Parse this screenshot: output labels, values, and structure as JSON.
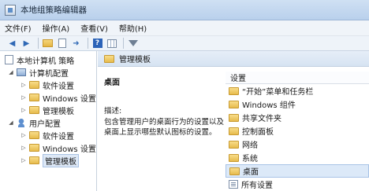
{
  "window": {
    "title": "本地组策略编辑器"
  },
  "menu": {
    "items": [
      "文件(F)",
      "操作(A)",
      "查看(V)",
      "帮助(H)"
    ]
  },
  "toolbar": {
    "icons": [
      "back-arrow-icon",
      "forward-arrow-icon",
      "folder-up-icon",
      "document-icon",
      "export-icon",
      "help-icon",
      "grid-icon",
      "filter-icon"
    ]
  },
  "tree": {
    "root": "本地计算机 策略",
    "computer": "计算机配置",
    "computer_children": [
      "软件设置",
      "Windows 设置",
      "管理模板"
    ],
    "user": "用户配置",
    "user_children": [
      "软件设置",
      "Windows 设置",
      "管理模板"
    ]
  },
  "header": {
    "title": "管理模板"
  },
  "description": {
    "title": "桌面",
    "label": "描述:",
    "text": "包含管理用户的桌面行为的设置以及桌面上显示哪些默认图标的设置。"
  },
  "settings": {
    "column_header": "设置",
    "items": [
      "“开始”菜单和任务栏",
      "Windows 组件",
      "共享文件夹",
      "控制面板",
      "网络",
      "系统",
      "桌面",
      "所有设置"
    ],
    "selected_index": 6
  }
}
